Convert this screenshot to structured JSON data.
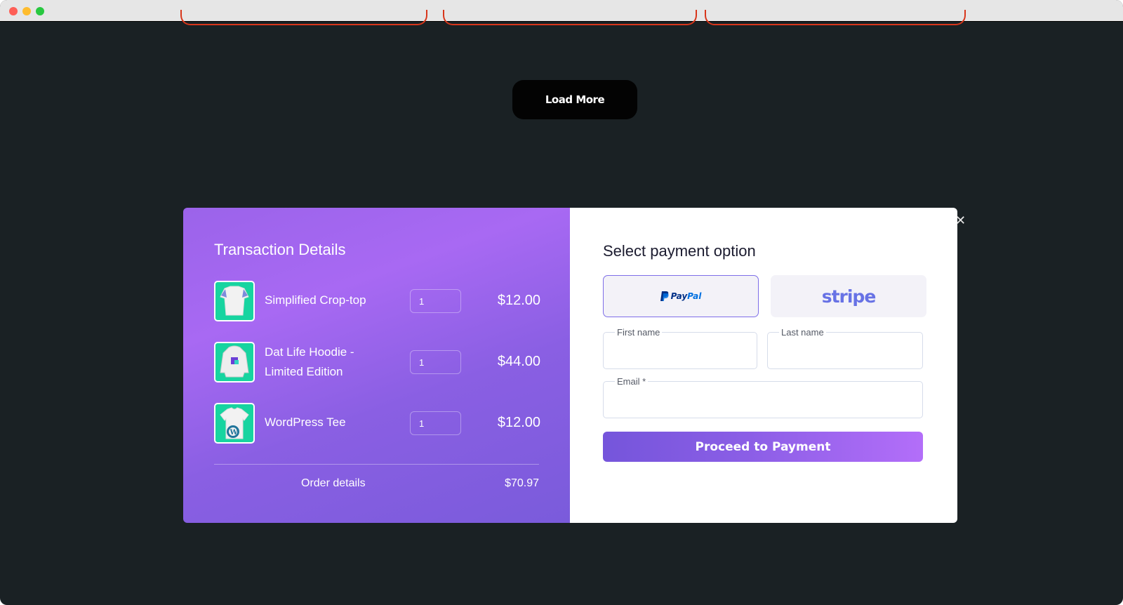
{
  "browser": {
    "traffic_lights": [
      "close",
      "minimize",
      "maximize"
    ]
  },
  "page": {
    "load_more_label": "Load More"
  },
  "modal": {
    "close_icon": "close-icon",
    "transaction": {
      "title": "Transaction Details",
      "items": [
        {
          "name": "Simplified Crop-top",
          "qty": "1",
          "price": "$12.00",
          "thumb_icon": "crop-top-image"
        },
        {
          "name_line1": "Dat Life Hoodie -",
          "name_line2": "Limited Edition",
          "qty": "1",
          "price": "$44.00",
          "thumb_icon": "hoodie-image"
        },
        {
          "name": "WordPress Tee",
          "qty": "1",
          "price": "$12.00",
          "thumb_icon": "wordpress-tee-image"
        }
      ],
      "order_label": "Order details",
      "order_total": "$70.97"
    },
    "payment": {
      "title": "Select payment option",
      "options": [
        {
          "id": "paypal",
          "label_a": "Pay",
          "label_b": "Pal",
          "selected": true
        },
        {
          "id": "stripe",
          "label": "stripe",
          "selected": false
        }
      ],
      "fields": {
        "first_name": {
          "label": "First name",
          "value": ""
        },
        "last_name": {
          "label": "Last name",
          "value": ""
        },
        "email": {
          "label": "Email *",
          "value": ""
        }
      },
      "submit_label": "Proceed to Payment"
    }
  },
  "colors": {
    "page_bg": "#1a2124",
    "accent_start": "#7555db",
    "accent_end": "#b36ef9",
    "thumb_bg": "#17d4a0",
    "card_border": "#d8361b",
    "stripe": "#6772e5",
    "paypal_dark": "#003087",
    "paypal_light": "#0070e0"
  }
}
